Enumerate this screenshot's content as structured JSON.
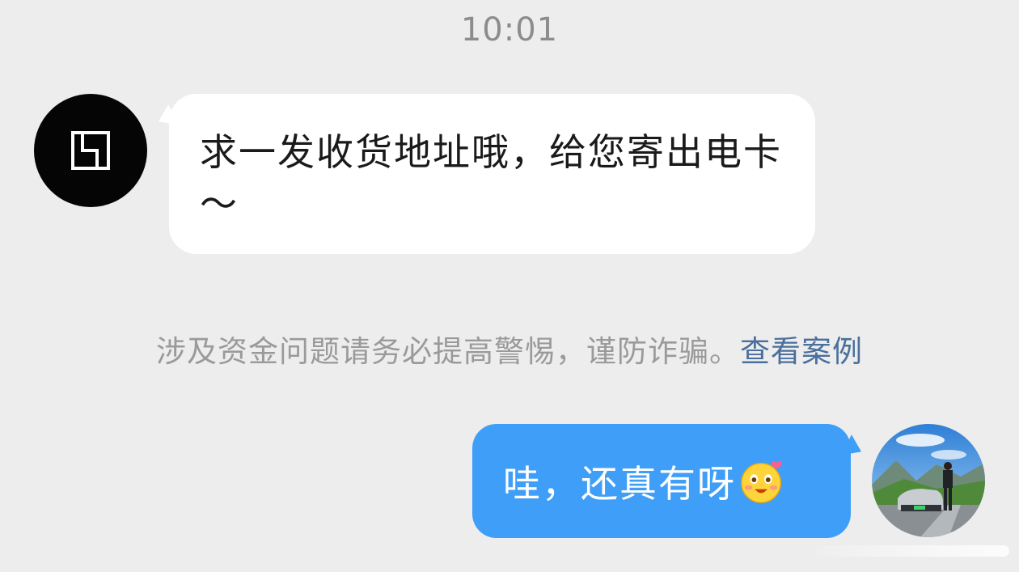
{
  "timestamp": "10:01",
  "incoming": {
    "avatar_icon": "brand-logo-icon",
    "text": "求一发收货地址哦，给您寄出电卡～"
  },
  "warning": {
    "text": "涉及资金问题请务必提高警惕，谨防诈骗。",
    "link_label": "查看案例"
  },
  "outgoing": {
    "text": "哇，还真有呀",
    "emoji_icon": "blushing-smile-emoji",
    "avatar_icon": "user-photo-avatar"
  },
  "colors": {
    "background": "#ededed",
    "incoming_bubble": "#ffffff",
    "outgoing_bubble": "#3f9ef7",
    "link": "#4a6f9c",
    "muted_text": "#9a9a9a"
  }
}
